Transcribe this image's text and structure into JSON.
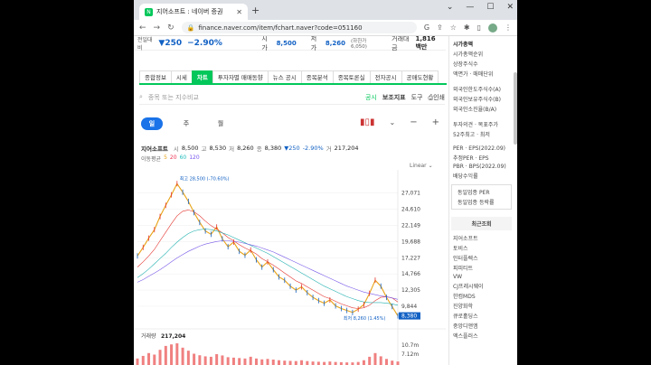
{
  "browser": {
    "tab_title": "지어소프트 : 네이버 증권",
    "url": "finance.naver.com/item/fchart.naver?code=051160"
  },
  "quote_bar": {
    "change_label": "전일대비",
    "change_arrow": "▼",
    "change_value": "250",
    "change_pct": "−2.90%",
    "open_label": "시가",
    "open_value": "8,500",
    "low_label": "저가",
    "low_value": "8,260",
    "low_limit": "(하한가 6,050)",
    "amount_label": "거래대금",
    "amount_value": "1,816 백만"
  },
  "tabs": [
    {
      "label": "종합정보",
      "active": false
    },
    {
      "label": "시세",
      "active": false
    },
    {
      "label": "차트",
      "active": true
    },
    {
      "label": "투자자별 매매동향",
      "active": false
    },
    {
      "label": "뉴스 공시",
      "active": false
    },
    {
      "label": "종목분석",
      "active": false
    },
    {
      "label": "종목토론실",
      "active": false
    },
    {
      "label": "전자공시",
      "active": false
    },
    {
      "label": "공매도현황",
      "active": false
    }
  ],
  "search": {
    "placeholder": "종목 또는 지수비교",
    "tools": [
      "공시",
      "보조지표",
      "도구",
      "인쇄"
    ]
  },
  "period": {
    "options": [
      "일",
      "주",
      "월"
    ],
    "selected": "일"
  },
  "info": {
    "name": "지어소프트",
    "open_label": "시",
    "open": "8,500",
    "high_label": "고",
    "high": "8,530",
    "low_label": "저",
    "low": "8,260",
    "close_label": "종",
    "close": "8,380",
    "change": "▼250",
    "pct": "-2.90%",
    "vol_label": "거",
    "vol": "217,204",
    "ma_label": "이동평균",
    "ma": [
      "5",
      "20",
      "60",
      "120"
    ]
  },
  "scale_label": "Linear",
  "chart_data": {
    "type": "line",
    "y_ticks": [
      "27,071",
      "24,610",
      "22,149",
      "19,688",
      "17,227",
      "14,766",
      "12,305",
      "9,844"
    ],
    "max_label": "최고 28,500 (-70.60%)",
    "min_label": "최저 8,260 (1.45%)",
    "last_price": "8,380",
    "volume_label": "거래량",
    "volume_value": "217,204",
    "volume_ticks": [
      "10.7m",
      "7.12m"
    ],
    "ylim": [
      7500,
      29500
    ],
    "series": [
      {
        "values": [
          17500,
          18800,
          20200,
          21500,
          23500,
          25200,
          26800,
          28500,
          27200,
          25800,
          24100,
          22600,
          21300,
          20800,
          21900,
          20100,
          18900,
          19600,
          18200,
          17600,
          18400,
          16900,
          15800,
          16600,
          15400,
          14300,
          13800,
          12900,
          12300,
          12800,
          11900,
          11200,
          10700,
          10300,
          10800,
          9900,
          9500,
          9200,
          8900,
          9400,
          10100,
          11800,
          13800,
          12900,
          11200,
          9800,
          8380
        ]
      },
      {
        "values": [
          15800,
          16600,
          17500,
          18500,
          19800,
          21100,
          22400,
          23600,
          24300,
          24500,
          24200,
          23600,
          22800,
          22100,
          21600,
          21000,
          20300,
          19800,
          19200,
          18700,
          18300,
          17800,
          17100,
          16600,
          16100,
          15500,
          14900,
          14300,
          13700,
          13300,
          12800,
          12300,
          11800,
          11300,
          11000,
          10600,
          10200,
          9900,
          9600,
          9500,
          9600,
          10000,
          10700,
          11200,
          11300,
          11100,
          10500
        ]
      },
      {
        "values": [
          14200,
          14800,
          15500,
          16300,
          17100,
          17900,
          18800,
          19600,
          20300,
          20900,
          21300,
          21500,
          21600,
          21500,
          21300,
          21000,
          20700,
          20300,
          19900,
          19500,
          19100,
          18700,
          18300,
          17900,
          17400,
          16900,
          16400,
          15900,
          15400,
          14900,
          14400,
          13900,
          13400,
          12900,
          12500,
          12100,
          11700,
          11300,
          11000,
          10700,
          10500,
          10400,
          10400,
          10400,
          10300,
          10200,
          10000
        ]
      },
      {
        "values": [
          13500,
          13900,
          14400,
          14900,
          15400,
          16000,
          16600,
          17200,
          17700,
          18200,
          18600,
          19000,
          19300,
          19500,
          19700,
          19800,
          19800,
          19700,
          19600,
          19400,
          19200,
          19000,
          18700,
          18400,
          18100,
          17700,
          17300,
          16900,
          16500,
          16100,
          15700,
          15300,
          14900,
          14500,
          14100,
          13700,
          13300,
          12900,
          12600,
          12300,
          12000,
          11800,
          11600,
          11400,
          11300,
          11100,
          10900
        ]
      }
    ],
    "volume": [
      30,
      42,
      55,
      48,
      70,
      88,
      95,
      100,
      80,
      66,
      52,
      45,
      40,
      38,
      50,
      44,
      36,
      34,
      32,
      30,
      38,
      30,
      26,
      28,
      25,
      22,
      20,
      19,
      18,
      22,
      18,
      16,
      15,
      14,
      16,
      14,
      13,
      12,
      12,
      14,
      22,
      38,
      55,
      40,
      28,
      20,
      16
    ]
  },
  "colors": {
    "price_line": "#e8a317",
    "ma20": "#e3342f",
    "ma60": "#23b0b0",
    "ma120": "#7a5ae8",
    "down": "#1261c4",
    "accent": "#03c75a"
  },
  "right_pane": {
    "lines": [
      "시가총액",
      "시가총액순위",
      "상장주식수",
      "액면가 · 매매단위"
    ],
    "foreign": [
      "외국인한도주식수(A)",
      "외국인보유주식수(B)",
      "외국인소진율(B/A)"
    ],
    "invest": [
      "투자의견 · 목표주가",
      "52주최고 · 최저"
    ],
    "per": [
      "PER · EPS(2022.09)",
      "추정PER · EPS",
      "PBR · BPS(2022.09)",
      "배당수익률"
    ],
    "same": [
      "동일업종 PER",
      "동일업종 등락률"
    ],
    "recent_title": "최근조회",
    "recent_items": [
      "지어소프트",
      "토비스",
      "인터플렉스",
      "피피티트",
      "VW",
      "CJ프레시웨이",
      "한컴MDS",
      "진양화학",
      "큐로홀딩스",
      "중앙디앤엠",
      "엑스플러스"
    ]
  }
}
